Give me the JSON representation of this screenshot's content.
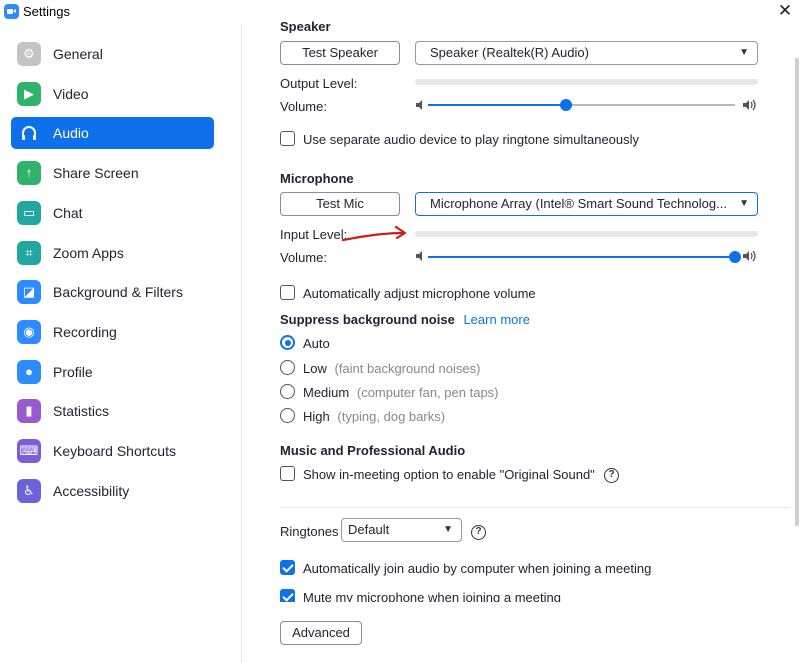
{
  "window": {
    "title": "Settings",
    "close_glyph": "✕"
  },
  "sidebar": {
    "items": [
      {
        "label": "General",
        "icon": "gear-icon",
        "color": "#c4c4c4",
        "glyph": "⚙"
      },
      {
        "label": "Video",
        "icon": "video-icon",
        "color": "#2fb36b",
        "glyph": "▶"
      },
      {
        "label": "Audio",
        "icon": "headphones-icon",
        "color": "#0e71eb",
        "glyph": "∩"
      },
      {
        "label": "Share Screen",
        "icon": "share-screen-icon",
        "color": "#2fb36b",
        "glyph": "↑"
      },
      {
        "label": "Chat",
        "icon": "chat-icon",
        "color": "#1fa7a0",
        "glyph": "▭"
      },
      {
        "label": "Zoom Apps",
        "icon": "zoom-apps-icon",
        "color": "#1fa7a0",
        "glyph": "⌗"
      },
      {
        "label": "Background & Filters",
        "icon": "background-icon",
        "color": "#2d8cff",
        "glyph": "◪"
      },
      {
        "label": "Recording",
        "icon": "recording-icon",
        "color": "#2d8cff",
        "glyph": "◉"
      },
      {
        "label": "Profile",
        "icon": "profile-icon",
        "color": "#2d8cff",
        "glyph": "●"
      },
      {
        "label": "Statistics",
        "icon": "statistics-icon",
        "color": "#9b59d0",
        "glyph": "▮"
      },
      {
        "label": "Keyboard Shortcuts",
        "icon": "keyboard-icon",
        "color": "#7b5fd6",
        "glyph": "⌨"
      },
      {
        "label": "Accessibility",
        "icon": "accessibility-icon",
        "color": "#6c63d9",
        "glyph": "♿"
      }
    ]
  },
  "speaker": {
    "heading": "Speaker",
    "test_button": "Test Speaker",
    "device": "Speaker (Realtek(R) Audio)",
    "output_level_label": "Output Level:",
    "volume_label": "Volume:",
    "volume": 0.45
  },
  "ringtone_device_checkbox": "Use separate audio device to play ringtone simultaneously",
  "microphone": {
    "heading": "Microphone",
    "test_button": "Test Mic",
    "device": "Microphone Array (Intel® Smart Sound Technolog...",
    "input_level_label": "Input Level:",
    "volume_label": "Volume:",
    "volume": 1.0
  },
  "auto_adjust_checkbox": "Automatically adjust microphone volume",
  "suppress": {
    "heading": "Suppress background noise",
    "learn_more": "Learn more",
    "options": [
      {
        "label": "Auto",
        "hint": ""
      },
      {
        "label": "Low",
        "hint": "(faint background noises)"
      },
      {
        "label": "Medium",
        "hint": "(computer fan, pen taps)"
      },
      {
        "label": "High",
        "hint": "(typing, dog barks)"
      }
    ],
    "selected": "Auto"
  },
  "music": {
    "heading": "Music and Professional Audio",
    "original_sound_checkbox": "Show in-meeting option to enable \"Original Sound\""
  },
  "ringtones": {
    "label": "Ringtones",
    "value": "Default"
  },
  "join_audio_checkbox": "Automatically join audio by computer when joining a meeting",
  "mute_mic_checkbox": "Mute my microphone when joining a meeting",
  "advanced_button": "Advanced",
  "annotation": {
    "color": "#d11a1a"
  },
  "colors": {
    "accent": "#0e71eb",
    "text": "#232333",
    "muted": "#888888"
  }
}
